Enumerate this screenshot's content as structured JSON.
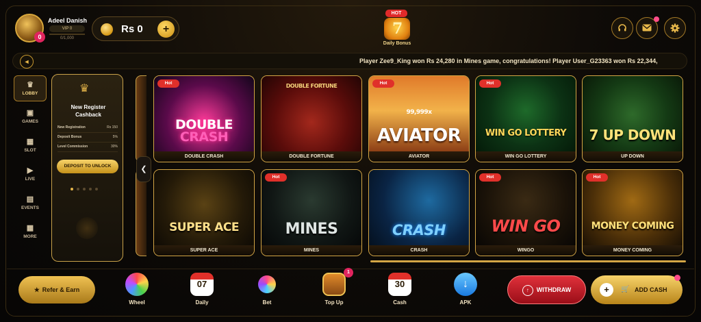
{
  "header": {
    "username": "Adeel Danish",
    "avatar_badge": "0",
    "vip_level": "VIP 0",
    "vip_progress": "0/1,000",
    "balance": "Rs 0",
    "daily_bonus_badge": "HOT",
    "daily_bonus_label": "Daily Bonus",
    "icons": [
      "headset-icon",
      "mail-icon",
      "settings-icon"
    ]
  },
  "ticker": {
    "text": "Player Zee9_King won Rs 24,280 in Mines game, congratulations! Player User_G23363 won Rs 22,344,"
  },
  "sidebar": {
    "items": [
      {
        "label": "LOBBY",
        "icon": "crown-icon"
      },
      {
        "label": "GAMES",
        "icon": "gamepad-icon"
      },
      {
        "label": "SLOT",
        "icon": "slot-icon"
      },
      {
        "label": "LIVE",
        "icon": "play-icon"
      },
      {
        "label": "EVENTS",
        "icon": "calendar-icon"
      },
      {
        "label": "MORE",
        "icon": "grid-icon"
      }
    ]
  },
  "promo": {
    "title": "New Register Cashback",
    "rows": [
      {
        "label": "New Registration",
        "value": "Rs 150"
      },
      {
        "label": "Deposit Bonus",
        "value": "5%"
      },
      {
        "label": "Level Commission",
        "value": "30%"
      }
    ],
    "button": "DEPOSIT TO UNLOCK"
  },
  "games": [
    {
      "title": "DOUBLE\nCRASH",
      "label": "DOUBLE CRASH",
      "hot": "Hot"
    },
    {
      "title": "DOUBLE\nFORTUNE",
      "label": "DOUBLE FORTUNE",
      "hot": ""
    },
    {
      "title": "AVIATOR",
      "subtitle": "99,999x",
      "label": "AVIATOR",
      "hot": "Hot"
    },
    {
      "title": "WIN GO LOTTERY",
      "label": "WIN GO LOTTERY",
      "hot": "Hot"
    },
    {
      "title": "7 UP DOWN",
      "label": "UP DOWN",
      "hot": ""
    },
    {
      "title": "SUPER ACE",
      "label": "SUPER ACE",
      "hot": ""
    },
    {
      "title": "MINES",
      "label": "MINES",
      "hot": "Hot"
    },
    {
      "title": "CRASH",
      "label": "CRASH",
      "hot": ""
    },
    {
      "title": "WIN GO",
      "label": "WINGO",
      "hot": "Hot"
    },
    {
      "title": "MONEY COMING",
      "label": "MONEY COMING",
      "hot": "Hot"
    }
  ],
  "bottom": {
    "refer": "Refer & Earn",
    "items": [
      {
        "label": "Wheel",
        "icon": "wheel-icon",
        "glyph": ""
      },
      {
        "label": "Daily",
        "icon": "calendar-icon",
        "glyph": "07"
      },
      {
        "label": "Bet",
        "icon": "spinner-icon",
        "glyph": ""
      },
      {
        "label": "Top Up",
        "icon": "treasure-chest-icon",
        "glyph": ""
      },
      {
        "label": "Cash",
        "icon": "calendar-icon",
        "glyph": "30"
      },
      {
        "label": "APK",
        "icon": "download-icon",
        "glyph": ""
      }
    ],
    "topup_badge": "1",
    "withdraw": "WITHDRAW",
    "add_cash": "ADD CASH"
  },
  "colors": {
    "gold": "#d4a645",
    "red": "#e0302a",
    "dark": "#0d0a07"
  }
}
